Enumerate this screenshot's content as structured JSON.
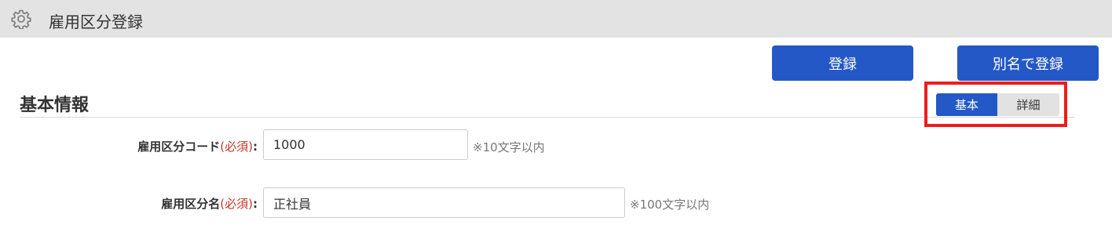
{
  "header": {
    "title": "雇用区分登録",
    "icon": "gear-icon"
  },
  "actions": {
    "register_label": "登録",
    "register_alias_label": "別名で登録"
  },
  "section": {
    "title": "基本情報"
  },
  "view_toggle": {
    "options": [
      "基本",
      "詳細"
    ],
    "selected": "基本"
  },
  "form": {
    "required_mark": "(必須)",
    "label_suffix": ":",
    "fields": [
      {
        "label": "雇用区分コード",
        "value": "1000",
        "hint": "※10文字以内"
      },
      {
        "label": "雇用区分名",
        "value": "正社員",
        "hint": "※100文字以内"
      }
    ]
  },
  "colors": {
    "primary": "#2458c7",
    "header_bg": "#e3e3e3",
    "required": "#c0392b",
    "highlight_border": "#ee1c1c",
    "hint": "#777777"
  }
}
